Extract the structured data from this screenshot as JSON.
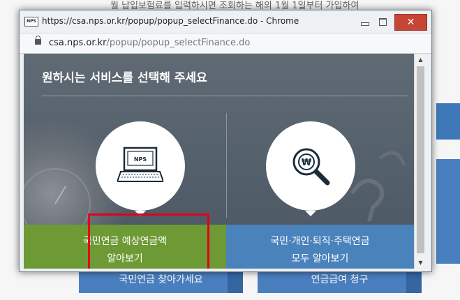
{
  "background": {
    "top_text": "월 납입보험료를 입력하시면 조회하는 해의 1월 1일부터 가입하여",
    "button_left": "국민연금 찾아가세요",
    "button_right": "연금급여 청구"
  },
  "window": {
    "favicon": "NPS",
    "title": "https://csa.nps.or.kr/popup/popup_selectFinance.do - Chrome",
    "close_glyph": "✕"
  },
  "address": {
    "domain": "csa.nps.or.kr",
    "path": "/popup/popup_selectFinance.do"
  },
  "content": {
    "heading": "원하시는 서비스를 선택해 주세요",
    "left_icon": "laptop-icon",
    "left_icon_text": "NPS",
    "right_icon": "magnifier-won-icon",
    "left_option": {
      "line1": "국민연금 예상연금액",
      "line2": "알아보기"
    },
    "right_option": {
      "line1": "국민·개인·퇴직·주택연금",
      "line2": "모두 알아보기"
    }
  },
  "colors": {
    "green_panel": "#6d9a35",
    "blue_panel": "#4a82bc",
    "highlight": "#e3001a",
    "close_button": "#c84536"
  }
}
